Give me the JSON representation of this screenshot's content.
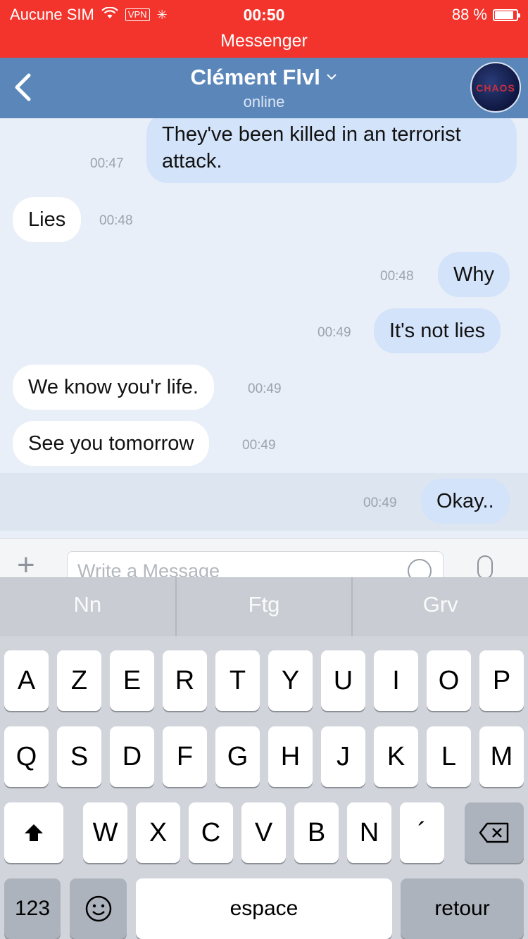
{
  "status_bar": {
    "carrier": "Aucune SIM",
    "vpn": "VPN",
    "time": "00:50",
    "battery": "88 %",
    "banner": "Messenger"
  },
  "header": {
    "back_icon": "chevron-left-icon",
    "title": "Clément Flvl",
    "title_chevron": "⌄",
    "subtitle": "online",
    "avatar_text": "CHAOS"
  },
  "messages": [
    {
      "direction": "out",
      "line1": "They've been killed in an terrorist",
      "line2": "attack.",
      "time": "00:47"
    },
    {
      "direction": "in",
      "text": "Lies",
      "time": "00:48"
    },
    {
      "direction": "out",
      "text": "Why",
      "time": "00:48"
    },
    {
      "direction": "out",
      "text": "It's not lies",
      "time": "00:49"
    },
    {
      "direction": "in",
      "text": "We know you'r life.",
      "time": "00:49"
    },
    {
      "direction": "in",
      "text": "See you tomorrow",
      "time": "00:49"
    },
    {
      "direction": "out",
      "text": "Okay..",
      "time": "00:49"
    }
  ],
  "composer": {
    "plus": "+",
    "placeholder": "Write a Message",
    "emoji_icon": "smiley-icon",
    "mic_icon": "microphone-icon"
  },
  "keyboard": {
    "predictions": [
      "Nn",
      "Ftg",
      "Grv"
    ],
    "row1": [
      "A",
      "Z",
      "E",
      "R",
      "T",
      "Y",
      "U",
      "I",
      "O",
      "P"
    ],
    "row2": [
      "Q",
      "S",
      "D",
      "F",
      "G",
      "H",
      "J",
      "K",
      "L",
      "M"
    ],
    "row3": [
      "W",
      "X",
      "C",
      "V",
      "B",
      "N",
      "´"
    ],
    "shift": "⬆",
    "delete": "⌫",
    "numbers": "123",
    "emoji": "☺",
    "space": "espace",
    "return": "retour"
  }
}
